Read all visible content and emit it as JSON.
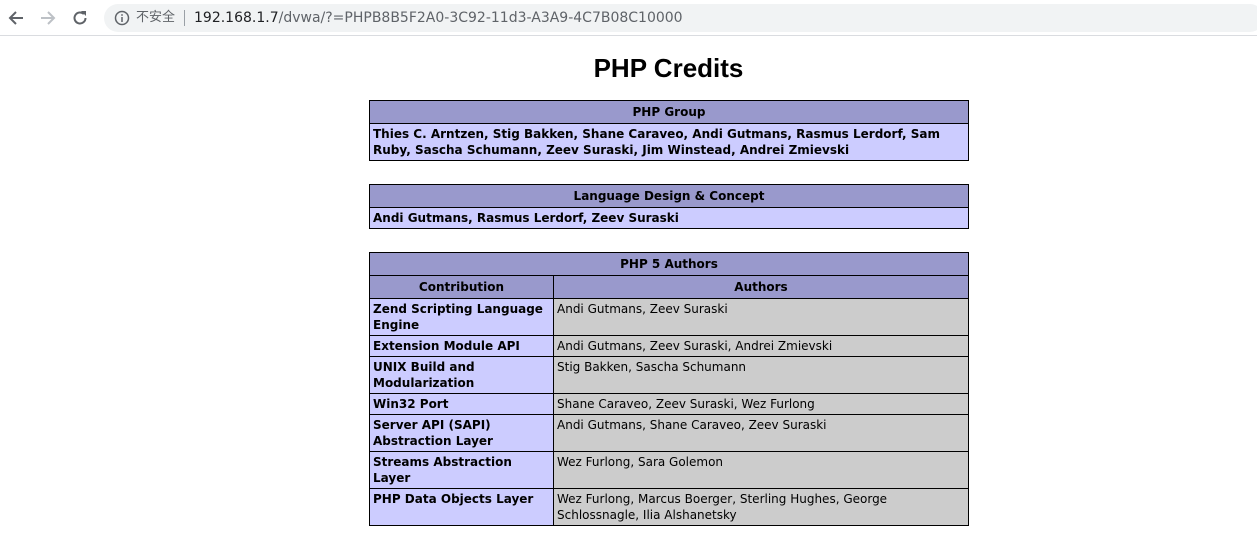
{
  "browser": {
    "security_label": "不安全",
    "url_host": "192.168.1.7",
    "url_path": "/dvwa/?=PHPB8B5F2A0-3C92-11d3-A3A9-4C7B08C10000"
  },
  "page": {
    "title": "PHP Credits",
    "php_group": {
      "header": "PHP Group",
      "members": "Thies C. Arntzen, Stig Bakken, Shane Caraveo, Andi Gutmans, Rasmus Lerdorf, Sam Ruby, Sascha Schumann, Zeev Suraski, Jim Winstead, Andrei Zmievski"
    },
    "language_design": {
      "header": "Language Design & Concept",
      "members": "Andi Gutmans, Rasmus Lerdorf, Zeev Suraski"
    },
    "php5_authors": {
      "header": "PHP 5 Authors",
      "col_contribution": "Contribution",
      "col_authors": "Authors",
      "rows": [
        {
          "contribution": "Zend Scripting Language Engine",
          "authors": "Andi Gutmans, Zeev Suraski"
        },
        {
          "contribution": "Extension Module API",
          "authors": "Andi Gutmans, Zeev Suraski, Andrei Zmievski"
        },
        {
          "contribution": "UNIX Build and Modularization",
          "authors": "Stig Bakken, Sascha Schumann"
        },
        {
          "contribution": "Win32 Port",
          "authors": "Shane Caraveo, Zeev Suraski, Wez Furlong"
        },
        {
          "contribution": "Server API (SAPI) Abstraction Layer",
          "authors": "Andi Gutmans, Shane Caraveo, Zeev Suraski"
        },
        {
          "contribution": "Streams Abstraction Layer",
          "authors": "Wez Furlong, Sara Golemon"
        },
        {
          "contribution": "PHP Data Objects Layer",
          "authors": "Wez Furlong, Marcus Boerger, Sterling Hughes, George Schlossnagle, Ilia Alshanetsky"
        }
      ]
    }
  },
  "colors": {
    "header_bg": "#9999cc",
    "label_bg": "#ccccff",
    "value_bg": "#cccccc"
  },
  "icons": [
    "back-arrow-icon",
    "forward-arrow-icon",
    "reload-icon",
    "info-icon"
  ]
}
